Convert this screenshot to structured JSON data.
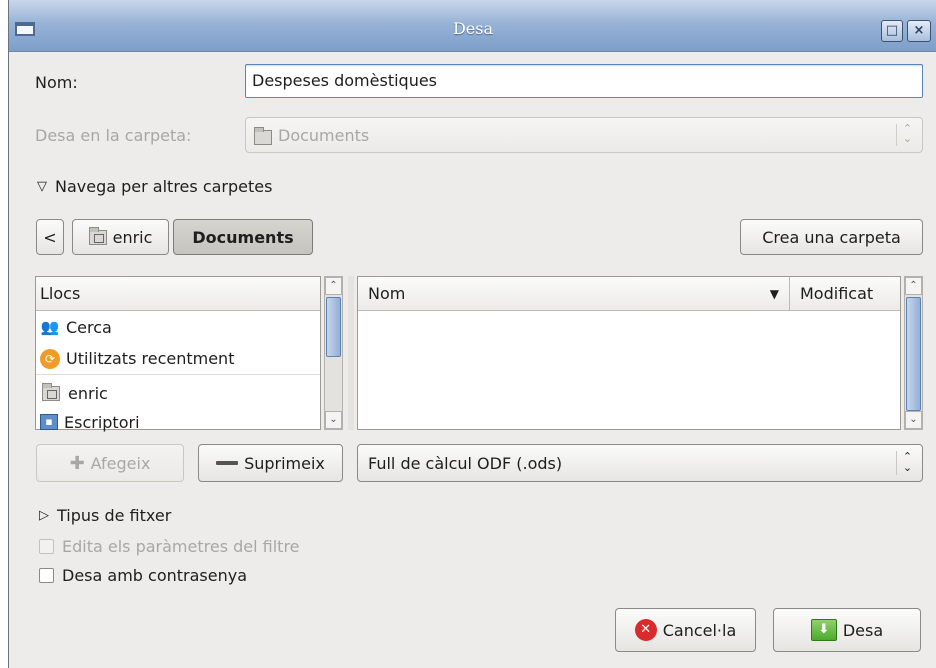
{
  "window": {
    "title": "Desa"
  },
  "name_field": {
    "label": "Nom:",
    "value": "Despeses domèstiques"
  },
  "save_in": {
    "label": "Desa en la carpeta:",
    "value": "Documents"
  },
  "browse": {
    "label": "Navega per altres carpetes"
  },
  "path_bar": {
    "back": "<",
    "crumbs": [
      "enric",
      "Documents"
    ],
    "create_folder": "Crea una carpeta"
  },
  "places": {
    "header": "Llocs",
    "items": [
      {
        "label": "Cerca",
        "icon": "binoculars-icon"
      },
      {
        "label": "Utilitzats recentment",
        "icon": "recent-icon"
      },
      {
        "label": "enric",
        "icon": "home-folder-icon"
      },
      {
        "label": "Escriptori",
        "icon": "desktop-icon"
      }
    ],
    "add_button": "Afegeix",
    "remove_button": "Suprimeix"
  },
  "files": {
    "columns": {
      "name": "Nom",
      "modified": "Modificat"
    }
  },
  "filter": {
    "value": "Full de càlcul ODF (.ods)"
  },
  "file_type": {
    "label": "Tipus de fitxer"
  },
  "options": {
    "edit_filter": "Edita els paràmetres del filtre",
    "password": "Desa amb contrasenya"
  },
  "actions": {
    "cancel": "Cancel·la",
    "save": "Desa"
  },
  "colors": {
    "accent": "#7e9ec9",
    "focus": "#5a86b8",
    "cancel_red": "#d92b2b",
    "save_green": "#4caa2d"
  }
}
